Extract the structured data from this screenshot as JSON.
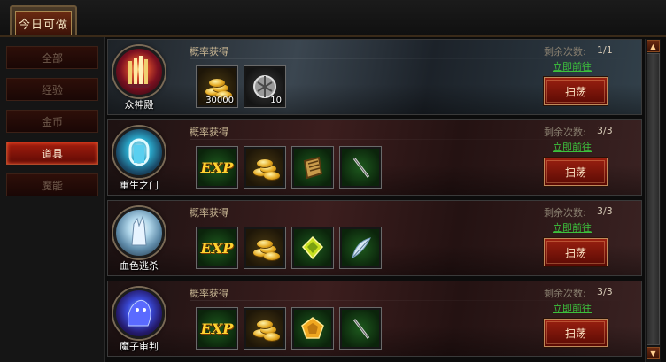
{
  "title_tab": "今日可做",
  "categories": [
    {
      "label": "全部",
      "active": false
    },
    {
      "label": "经验",
      "active": false
    },
    {
      "label": "金币",
      "active": false
    },
    {
      "label": "道具",
      "active": true
    },
    {
      "label": "魔能",
      "active": false
    }
  ],
  "labels": {
    "drop": "概率获得",
    "remaining": "剩余次数:",
    "goto": "立即前往",
    "sweep": "扫荡"
  },
  "dungeons": [
    {
      "name": "众神殿",
      "remaining": "1/1",
      "rewards": [
        {
          "icon": "gold-coins-icon",
          "count": "30000"
        },
        {
          "icon": "silver-orb-icon",
          "count": "10"
        }
      ]
    },
    {
      "name": "重生之门",
      "remaining": "3/3",
      "rewards": [
        {
          "icon": "exp-icon",
          "text": "EXP"
        },
        {
          "icon": "gold-coins-icon"
        },
        {
          "icon": "scroll-book-icon"
        },
        {
          "icon": "sword-icon"
        }
      ]
    },
    {
      "name": "血色逃杀",
      "remaining": "3/3",
      "rewards": [
        {
          "icon": "exp-icon",
          "text": "EXP"
        },
        {
          "icon": "gold-coins-icon"
        },
        {
          "icon": "green-gem-icon"
        },
        {
          "icon": "feather-icon"
        }
      ]
    },
    {
      "name": "魔子审判",
      "remaining": "3/3",
      "rewards": [
        {
          "icon": "exp-icon",
          "text": "EXP"
        },
        {
          "icon": "gold-coins-icon"
        },
        {
          "icon": "pentagon-gem-icon"
        },
        {
          "icon": "sword-icon"
        }
      ]
    }
  ],
  "colors": {
    "accent_red": "#a51e0e",
    "link_green": "#3cc03c",
    "text_gold": "#c4b290"
  }
}
